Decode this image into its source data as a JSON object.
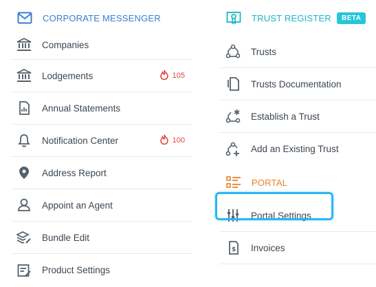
{
  "corporate": {
    "title": "CORPORATE MESSENGER",
    "items": [
      {
        "label": "Companies",
        "icon": "bank-icon"
      },
      {
        "label": "Lodgements",
        "icon": "bank-icon",
        "count": "105"
      },
      {
        "label": "Annual Statements",
        "icon": "report-document-icon"
      },
      {
        "label": "Notification Center",
        "icon": "bell-icon",
        "count": "100"
      },
      {
        "label": "Address Report",
        "icon": "map-pin-icon"
      },
      {
        "label": "Appoint an Agent",
        "icon": "user-icon"
      },
      {
        "label": "Bundle Edit",
        "icon": "layers-edit-icon"
      },
      {
        "label": "Product Settings",
        "icon": "edit-list-icon"
      }
    ]
  },
  "trust": {
    "title": "TRUST REGISTER",
    "badge": "BETA",
    "items": [
      {
        "label": "Trusts",
        "icon": "trust-nodes-icon"
      },
      {
        "label": "Trusts Documentation",
        "icon": "documents-icon"
      },
      {
        "label": "Establish a Trust",
        "icon": "trust-establish-icon"
      },
      {
        "label": "Add an Existing Trust",
        "icon": "trust-add-icon"
      }
    ]
  },
  "portal": {
    "title": "PORTAL",
    "items": [
      {
        "label": "Portal Settings",
        "icon": "sliders-icon",
        "highlighted": true
      },
      {
        "label": "Invoices",
        "icon": "invoice-icon"
      }
    ]
  },
  "colors": {
    "corporate_accent": "#3a7bd5",
    "trust_accent": "#1bb6c9",
    "portal_accent": "#e8822a",
    "count_red": "#e0443a",
    "highlight_blue": "#29b6f6"
  }
}
